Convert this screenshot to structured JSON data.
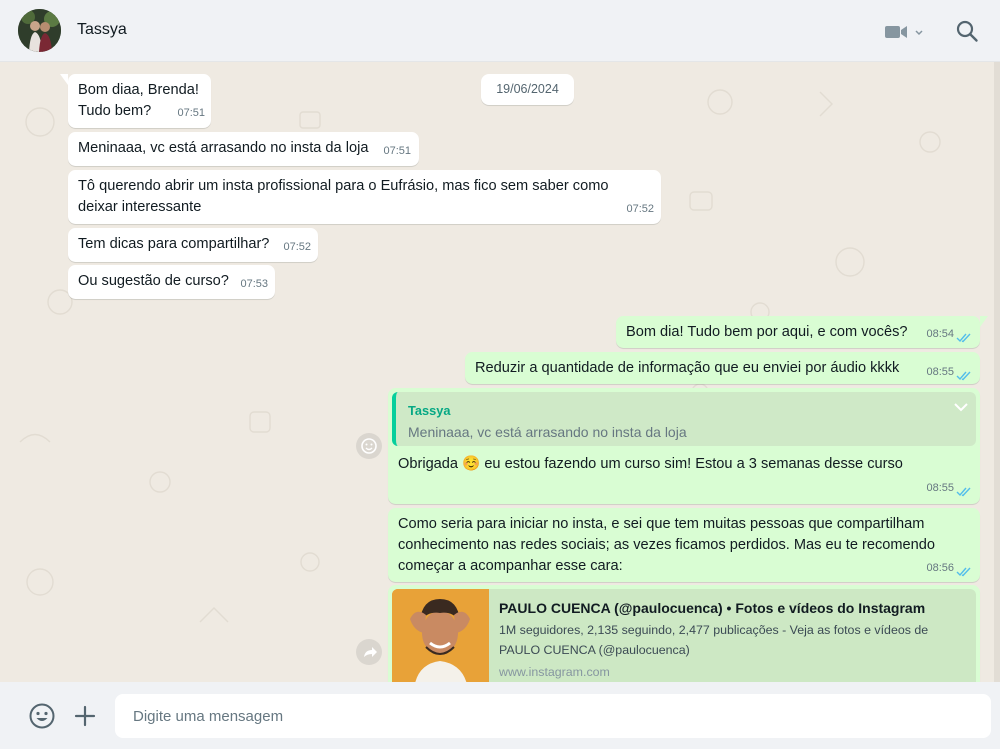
{
  "header": {
    "contact_name": "Tassya"
  },
  "chat": {
    "date_chip": "19/06/2024",
    "incoming": [
      {
        "lines": [
          "Bom diaa, Brenda!",
          "Tudo bem?"
        ],
        "time": "07:51"
      },
      {
        "lines": [
          "Meninaaa, vc está arrasando no insta da loja"
        ],
        "time": "07:51"
      },
      {
        "lines": [
          "Tô querendo abrir um insta profissional para o Eufrásio, mas fico sem saber como",
          "deixar interessante"
        ],
        "time": "07:52"
      },
      {
        "lines": [
          "Tem dicas para compartilhar?"
        ],
        "time": "07:52"
      },
      {
        "lines": [
          "Ou sugestão de curso?"
        ],
        "time": "07:53"
      }
    ],
    "outgoing": [
      {
        "text": "Bom dia! Tudo bem por aqui, e com vocês?",
        "time": "08:54"
      },
      {
        "text": "Reduzir a quantidade de informação que eu enviei por áudio kkkk",
        "time": "08:55"
      },
      {
        "quote_author": "Tassya",
        "quote_text": "Meninaaa, vc está arrasando no insta da loja",
        "text_before_emoji": "Obrigada ",
        "emoji": "☺️",
        "text_after_emoji": " eu estou fazendo um curso sim! Estou a 3 semanas desse curso",
        "time": "08:55"
      },
      {
        "lines": [
          "Como seria para iniciar no insta, e sei que tem muitas pessoas que compartilham",
          "conhecimento nas redes sociais; as vezes ficamos perdidos. Mas eu te recomendo",
          "começar a acompanhar esse cara:"
        ],
        "time": "08:56"
      }
    ],
    "link_preview": {
      "title": "PAULO CUENCA (@paulocuenca) • Fotos e vídeos do Instagram",
      "description": "1M seguidores, 2,135 seguindo, 2,477 publicações - Veja as fotos e vídeos de PAULO CUENCA (@paulocuenca)",
      "domain": "www.instagram.com"
    }
  },
  "footer": {
    "input_placeholder": "Digite uma mensagem"
  },
  "colors": {
    "header_bg": "#f0f2f5",
    "chat_bg": "#efeae2",
    "incoming_bubble": "#ffffff",
    "outgoing_bubble": "#d9fdd3",
    "read_ticks": "#53bdeb",
    "quote_accent": "#06cf9c"
  }
}
